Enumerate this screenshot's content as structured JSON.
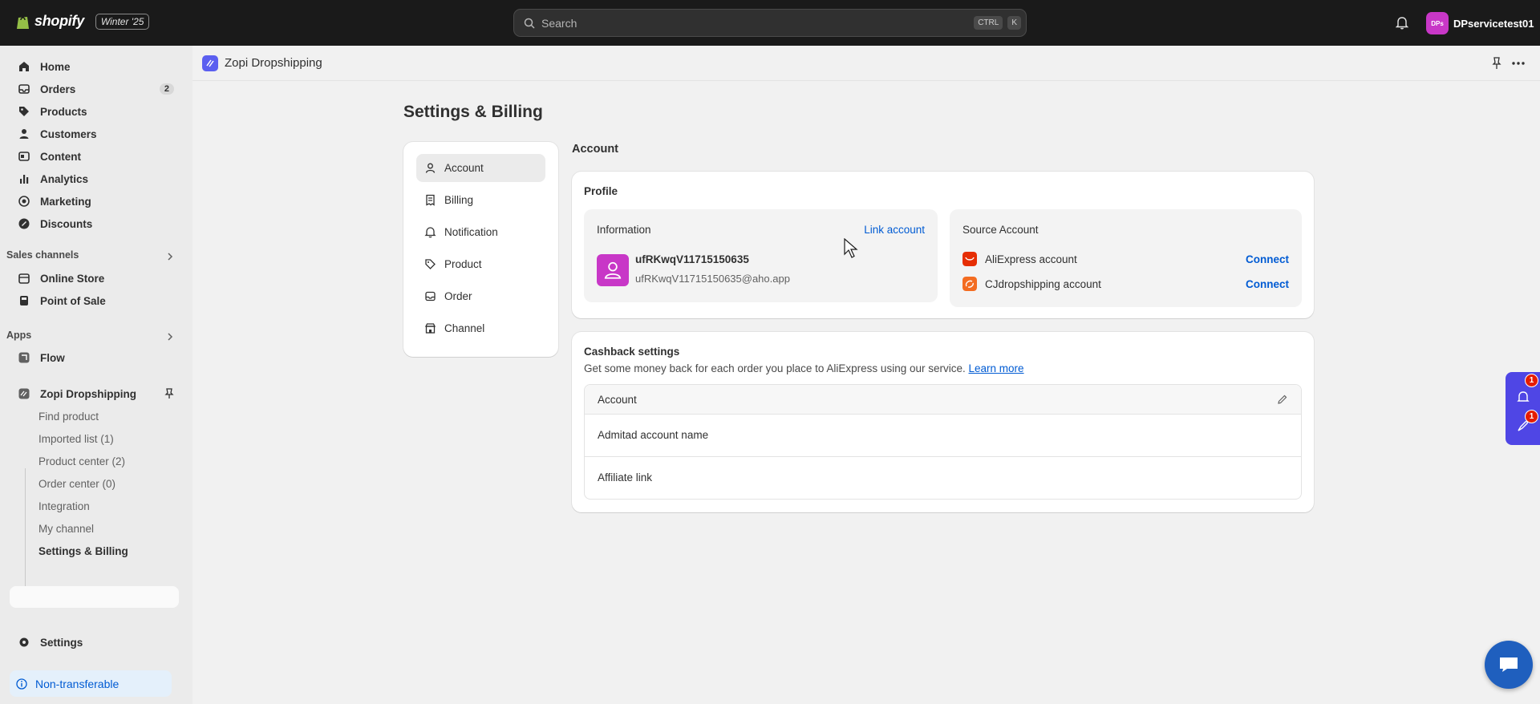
{
  "topbar": {
    "brand": "shopify",
    "edition": "Winter '25",
    "search_placeholder": "Search",
    "shortcut_keys": [
      "CTRL",
      "K"
    ],
    "user_initials": "DPs",
    "user_name": "DPservicetest01"
  },
  "sidebar": {
    "main_items": [
      {
        "label": "Home",
        "icon": "home-icon"
      },
      {
        "label": "Orders",
        "icon": "orders-icon",
        "badge": "2"
      },
      {
        "label": "Products",
        "icon": "tag-icon"
      },
      {
        "label": "Customers",
        "icon": "person-icon"
      },
      {
        "label": "Content",
        "icon": "content-icon"
      },
      {
        "label": "Analytics",
        "icon": "bar-chart-icon"
      },
      {
        "label": "Marketing",
        "icon": "target-icon"
      },
      {
        "label": "Discounts",
        "icon": "discount-icon"
      }
    ],
    "sales_channels_title": "Sales channels",
    "sales_channels": [
      {
        "label": "Online Store",
        "icon": "store-icon"
      },
      {
        "label": "Point of Sale",
        "icon": "pos-icon"
      }
    ],
    "apps_title": "Apps",
    "apps": [
      {
        "label": "Flow",
        "icon": "flow-icon"
      },
      {
        "label": "Zopi Dropshipping",
        "icon": "zopi-icon"
      }
    ],
    "zopi_sub_items": [
      "Find product",
      "Imported list (1)",
      "Product center (2)",
      "Order center (0)",
      "Integration",
      "My channel",
      "Settings & Billing"
    ],
    "settings_label": "Settings",
    "non_transferable": "Non-transferable"
  },
  "app_header": {
    "app_name": "Zopi Dropshipping"
  },
  "page": {
    "title": "Settings & Billing",
    "menu": [
      {
        "label": "Account",
        "icon": "person-icon",
        "active": true
      },
      {
        "label": "Billing",
        "icon": "receipt-icon"
      },
      {
        "label": "Notification",
        "icon": "bell-icon"
      },
      {
        "label": "Product",
        "icon": "tag-icon"
      },
      {
        "label": "Order",
        "icon": "inbox-icon"
      },
      {
        "label": "Channel",
        "icon": "store-icon"
      }
    ],
    "section_heading": "Account",
    "profile": {
      "title": "Profile",
      "information_label": "Information",
      "link_account": "Link account",
      "username": "ufRKwqV11715150635",
      "email": "ufRKwqV11715150635@aho.app",
      "source_account_label": "Source Account",
      "sources": [
        {
          "name": "AliExpress account",
          "action": "Connect",
          "color": "#e62e04"
        },
        {
          "name": "CJdropshipping account",
          "action": "Connect",
          "color": "#f36c21"
        }
      ]
    },
    "cashback": {
      "title": "Cashback settings",
      "description": "Get some money back for each order you place to AliExpress using our service.",
      "learn_more": "Learn more",
      "table_header": "Account",
      "rows": [
        "Admitad account name",
        "Affiliate link"
      ]
    }
  },
  "widgets": {
    "notification_badge": "1",
    "launch_badge": "1"
  },
  "colors": {
    "topbar_bg": "#1a1a1a",
    "link_blue": "#005bd3",
    "avatar_magenta": "#c837c7",
    "widget_purple": "#4f46e5"
  }
}
